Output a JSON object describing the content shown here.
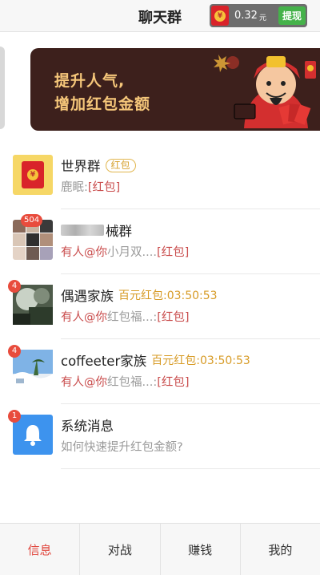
{
  "header": {
    "title": "聊天群",
    "wallet": {
      "amount": "0.32",
      "unit": "元",
      "withdraw_label": "提现"
    }
  },
  "banner": {
    "line1": "提升人气,",
    "line2": "增加红包金额"
  },
  "chats": [
    {
      "name": "世界群",
      "tag": "红包",
      "sender": "鹿眠:",
      "message": "",
      "red_packet": "[红包]",
      "badge": ""
    },
    {
      "name": "械群",
      "badge": "504",
      "mention": "有人@你",
      "message": "小月双....",
      "red_packet": "[红包]"
    },
    {
      "name": "偶遇家族",
      "badge": "4",
      "timer": "百元红包:03:50:53",
      "mention": "有人@你",
      "message": "红包福...:",
      "red_packet": "[红包]"
    },
    {
      "name": "coffeeter家族",
      "badge": "4",
      "timer": "百元红包:03:50:53",
      "mention": "有人@你",
      "message": "红包福...:",
      "red_packet": "[红包]"
    },
    {
      "name": "系统消息",
      "badge": "1",
      "message": "如何快速提升红包金额?"
    }
  ],
  "tabs": [
    {
      "label": "信息",
      "active": true
    },
    {
      "label": "对战",
      "active": false
    },
    {
      "label": "赚钱",
      "active": false
    },
    {
      "label": "我的",
      "active": false
    }
  ],
  "colors": {
    "accent_red": "#e0443b",
    "gold": "#d79b26",
    "withdraw_green": "#45b24a"
  }
}
